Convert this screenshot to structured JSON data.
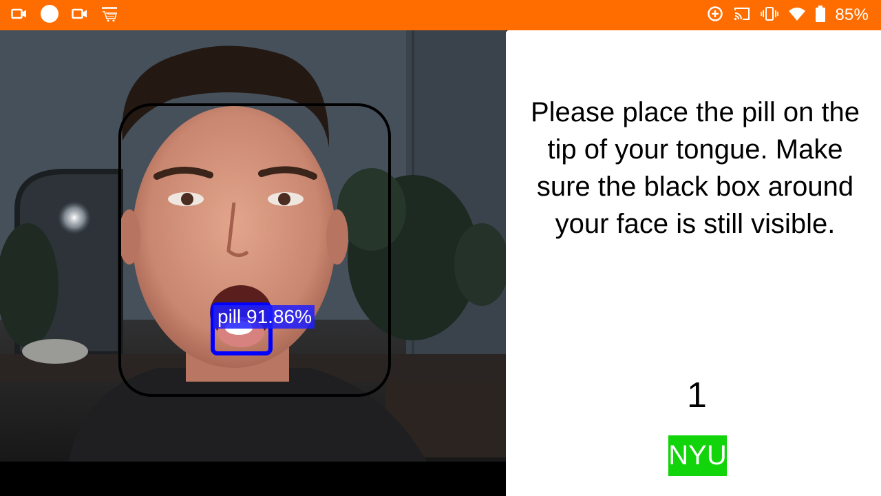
{
  "status_bar": {
    "background_color": "#ff6d00",
    "left_icons": [
      "camera-icon",
      "circle-icon",
      "camera-icon",
      "amazon-shopping-icon"
    ],
    "right_icons": [
      "data-saver-icon",
      "cast-icon",
      "vibrate-icon",
      "wifi-icon",
      "battery-icon"
    ],
    "battery_percent": "85%"
  },
  "camera": {
    "detection": {
      "label": "pill 91.86%",
      "box_color": "#0000ff"
    },
    "face_box_color": "#000000"
  },
  "panel": {
    "instructions": "Please place the pill on the tip of your tongue. Make sure the black box around your face is still visible.",
    "counter": "1",
    "badge_text": "NYU",
    "badge_color": "#11d40a"
  }
}
